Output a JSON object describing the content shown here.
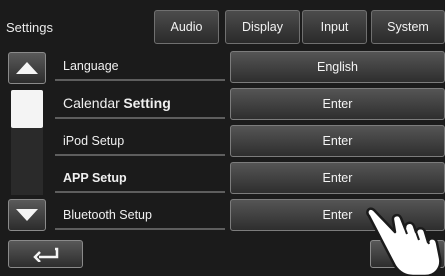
{
  "header": {
    "title": "Settings",
    "tabs": [
      "Audio",
      "Display",
      "Input",
      "System"
    ]
  },
  "rows": [
    {
      "label": "Language",
      "value": "English"
    },
    {
      "label_part1": "Calendar",
      "label_part2": "Setting",
      "value": "Enter"
    },
    {
      "label": "iPod Setup",
      "value": "Enter"
    },
    {
      "label": "APP Setup",
      "value": "Enter"
    },
    {
      "label": "Bluetooth Setup",
      "value": "Enter"
    }
  ],
  "icons": {
    "scroll_up": "triangle-up-icon",
    "scroll_down": "triangle-down-icon",
    "back": "return-arrow-icon",
    "pointer": "pointing-hand-icon"
  }
}
